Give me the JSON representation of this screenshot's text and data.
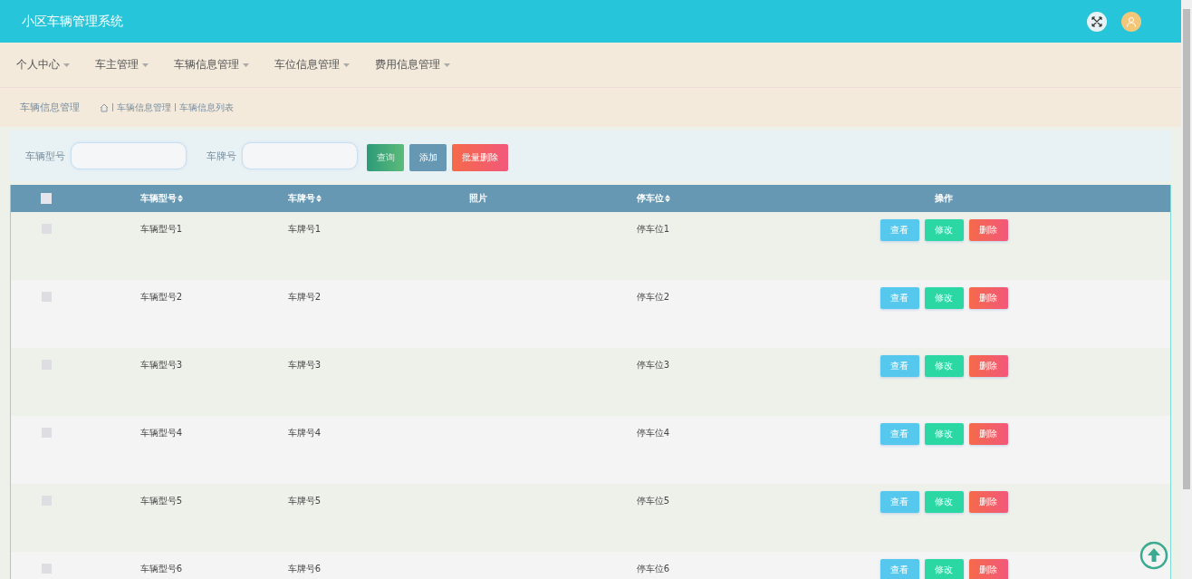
{
  "header": {
    "title": "小区车辆管理系统"
  },
  "nav": [
    {
      "label": "个人中心"
    },
    {
      "label": "车主管理"
    },
    {
      "label": "车辆信息管理"
    },
    {
      "label": "车位信息管理"
    },
    {
      "label": "费用信息管理"
    }
  ],
  "breadcrumb": {
    "title": "车辆信息管理",
    "path": [
      "车辆信息管理",
      "车辆信息列表"
    ]
  },
  "search": {
    "fields": [
      {
        "label": "车辆型号"
      },
      {
        "label": "车牌号"
      }
    ],
    "buttons": [
      {
        "label": "查询",
        "kind": "search"
      },
      {
        "label": "添加",
        "kind": "add"
      },
      {
        "label": "批量删除",
        "kind": "delete"
      }
    ]
  },
  "table": {
    "all_checked": false,
    "columns": [
      {
        "label": "车辆型号",
        "sortable": true
      },
      {
        "label": "车牌号",
        "sortable": true
      },
      {
        "label": "照片",
        "sortable": false
      },
      {
        "label": "停车位",
        "sortable": true
      },
      {
        "label": "操作",
        "sortable": false
      }
    ],
    "rows": [
      {
        "checked": false,
        "model": "车辆型号1",
        "plate": "车牌号1",
        "stall": "停车位1",
        "actions": [
          "查看",
          "修改",
          "删除"
        ]
      },
      {
        "checked": false,
        "model": "车辆型号2",
        "plate": "车牌号2",
        "stall": "停车位2",
        "actions": [
          "查看",
          "修改",
          "删除"
        ]
      },
      {
        "checked": false,
        "model": "车辆型号3",
        "plate": "车牌号3",
        "stall": "停车位3",
        "actions": [
          "查看",
          "修改",
          "删除"
        ]
      },
      {
        "checked": false,
        "model": "车辆型号4",
        "plate": "车牌号4",
        "stall": "停车位4",
        "actions": [
          "查看",
          "修改",
          "删除"
        ]
      },
      {
        "checked": false,
        "model": "车辆型号5",
        "plate": "车牌号5",
        "stall": "停车位5",
        "actions": [
          "查看",
          "修改",
          "删除"
        ]
      },
      {
        "checked": false,
        "model": "车辆型号6",
        "plate": "车牌号6",
        "stall": "停车位6",
        "actions": [
          "查看",
          "修改",
          "删除"
        ]
      }
    ]
  }
}
